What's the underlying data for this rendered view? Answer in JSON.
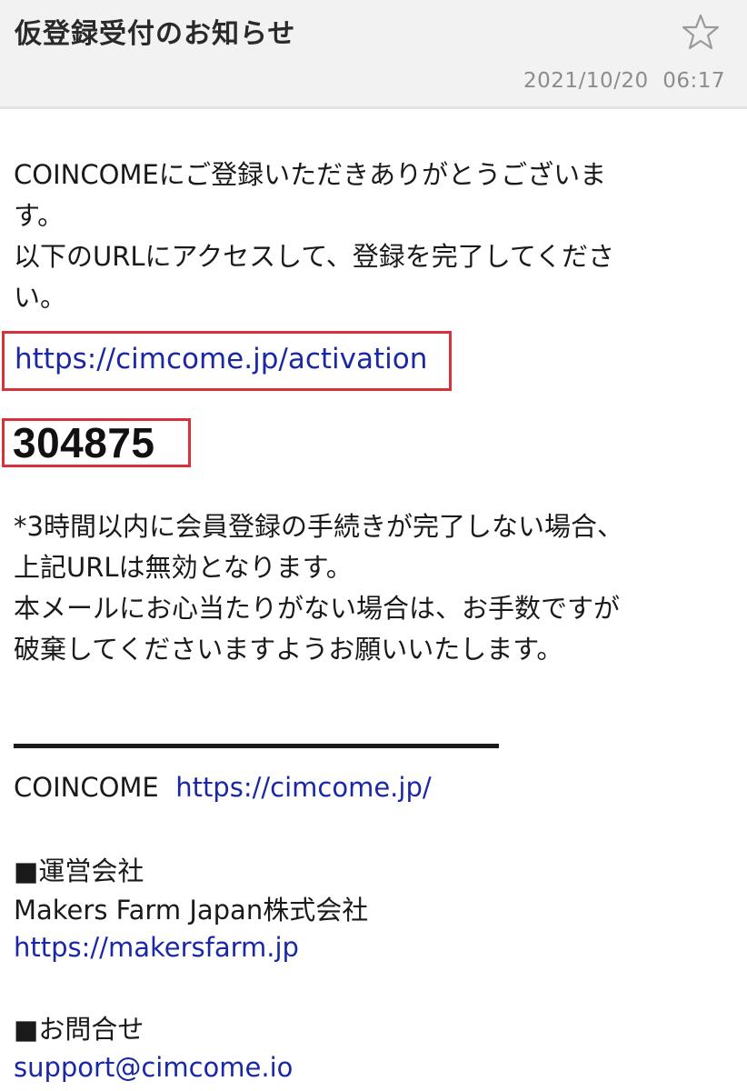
{
  "header": {
    "subject": "仮登録受付のお知らせ",
    "date": "2021/10/20  06:17",
    "star_icon": "star-outline-icon"
  },
  "body": {
    "line1": "COINCOMEにご登録いただきありがとうございま",
    "line2": "す。",
    "line3": "以下のURLにアクセスして、登録を完了してくださ",
    "line4": "い。",
    "activation_url": "https://cimcome.jp/activation",
    "code": "304875",
    "notice1": "*3時間以内に会員登録の手続きが完了しない場合、",
    "notice2": "上記URLは無効となります。",
    "notice3": "本メールにお心当たりがない場合は、お手数ですが",
    "notice4": "破棄してくださいますようお願いいたします。"
  },
  "footer": {
    "brand": "COINCOME",
    "brand_url": "https://cimcome.jp/",
    "operator_heading": "■運営会社",
    "operator_name": "Makers Farm Japan株式会社",
    "operator_url": "https://makersfarm.jp",
    "contact_heading": "■お問合せ",
    "contact_email": "support@cimcome.io"
  },
  "colors": {
    "link": "#1a28a4",
    "highlight_border": "#d9313c",
    "header_bg": "#f2f2f2"
  }
}
